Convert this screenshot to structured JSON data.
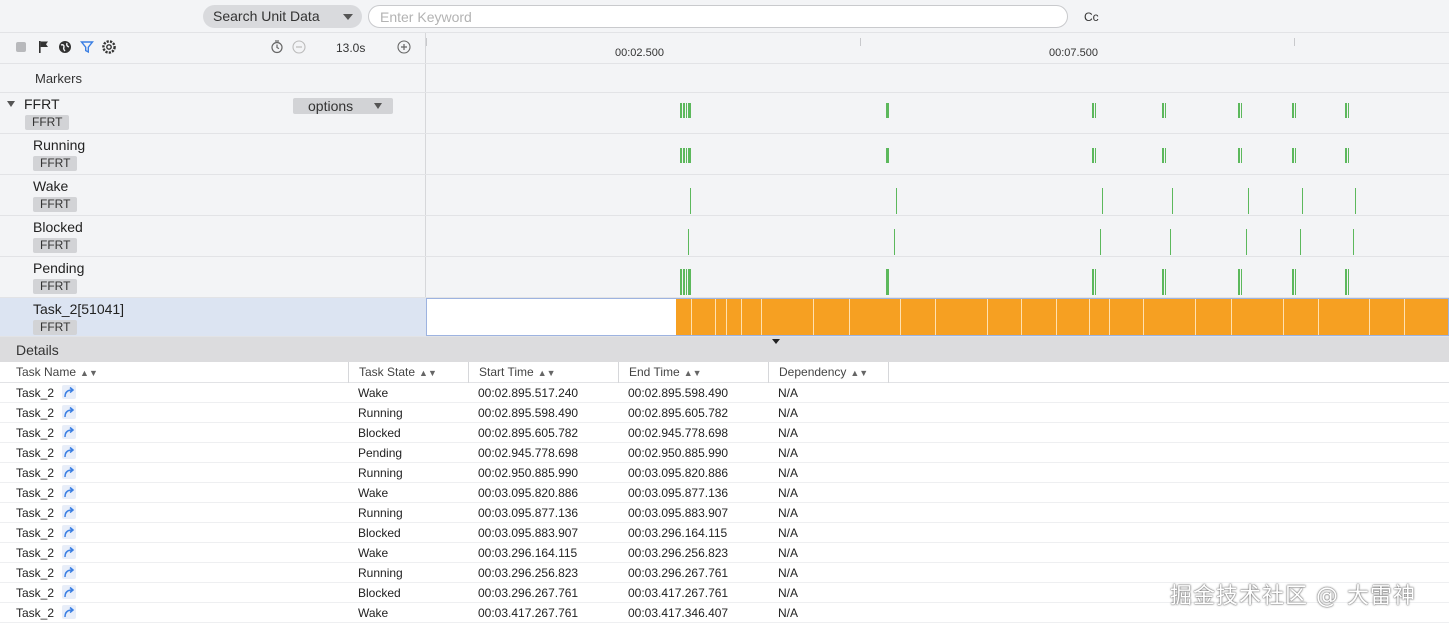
{
  "search": {
    "scope_label": "Search Unit Data",
    "placeholder": "Enter Keyword",
    "case_toggle_label": "Cc"
  },
  "toolbar": {
    "icons": [
      "square-icon",
      "flag-icon",
      "globe-icon",
      "filter-icon",
      "settings-icon",
      "clock-reset-icon",
      "zoom-out-icon",
      "zoom-in-icon"
    ],
    "zoom_value": "13.0s"
  },
  "timeline": {
    "markers_label": "Markers",
    "ruler_labels": [
      "00:02.500",
      "00:07.500"
    ],
    "rows": [
      {
        "name": "FFRT",
        "tag": "FFRT",
        "options_label": "options"
      },
      {
        "name": "Running",
        "tag": "FFRT"
      },
      {
        "name": "Wake",
        "tag": "FFRT"
      },
      {
        "name": "Blocked",
        "tag": "FFRT"
      },
      {
        "name": "Pending",
        "tag": "FFRT"
      },
      {
        "name": "Task_2[51041]",
        "tag": "FFRT"
      }
    ],
    "accent_green": "#5cb85c",
    "accent_orange": "#f6a022"
  },
  "details": {
    "title": "Details",
    "columns": [
      "Task Name",
      "Task State",
      "Start Time",
      "End Time",
      "Dependency"
    ],
    "rows": [
      {
        "name": "Task_2",
        "state": "Wake",
        "start": "00:02.895.517.240",
        "end": "00:02.895.598.490",
        "dep": "N/A"
      },
      {
        "name": "Task_2",
        "state": "Running",
        "start": "00:02.895.598.490",
        "end": "00:02.895.605.782",
        "dep": "N/A"
      },
      {
        "name": "Task_2",
        "state": "Blocked",
        "start": "00:02.895.605.782",
        "end": "00:02.945.778.698",
        "dep": "N/A"
      },
      {
        "name": "Task_2",
        "state": "Pending",
        "start": "00:02.945.778.698",
        "end": "00:02.950.885.990",
        "dep": "N/A"
      },
      {
        "name": "Task_2",
        "state": "Running",
        "start": "00:02.950.885.990",
        "end": "00:03.095.820.886",
        "dep": "N/A"
      },
      {
        "name": "Task_2",
        "state": "Wake",
        "start": "00:03.095.820.886",
        "end": "00:03.095.877.136",
        "dep": "N/A"
      },
      {
        "name": "Task_2",
        "state": "Running",
        "start": "00:03.095.877.136",
        "end": "00:03.095.883.907",
        "dep": "N/A"
      },
      {
        "name": "Task_2",
        "state": "Blocked",
        "start": "00:03.095.883.907",
        "end": "00:03.296.164.115",
        "dep": "N/A"
      },
      {
        "name": "Task_2",
        "state": "Wake",
        "start": "00:03.296.164.115",
        "end": "00:03.296.256.823",
        "dep": "N/A"
      },
      {
        "name": "Task_2",
        "state": "Running",
        "start": "00:03.296.256.823",
        "end": "00:03.296.267.761",
        "dep": "N/A"
      },
      {
        "name": "Task_2",
        "state": "Blocked",
        "start": "00:03.296.267.761",
        "end": "00:03.417.267.761",
        "dep": "N/A"
      },
      {
        "name": "Task_2",
        "state": "Wake",
        "start": "00:03.417.267.761",
        "end": "00:03.417.346.407",
        "dep": "N/A"
      }
    ]
  },
  "watermark": "掘金技术社区 @ 大雷神"
}
